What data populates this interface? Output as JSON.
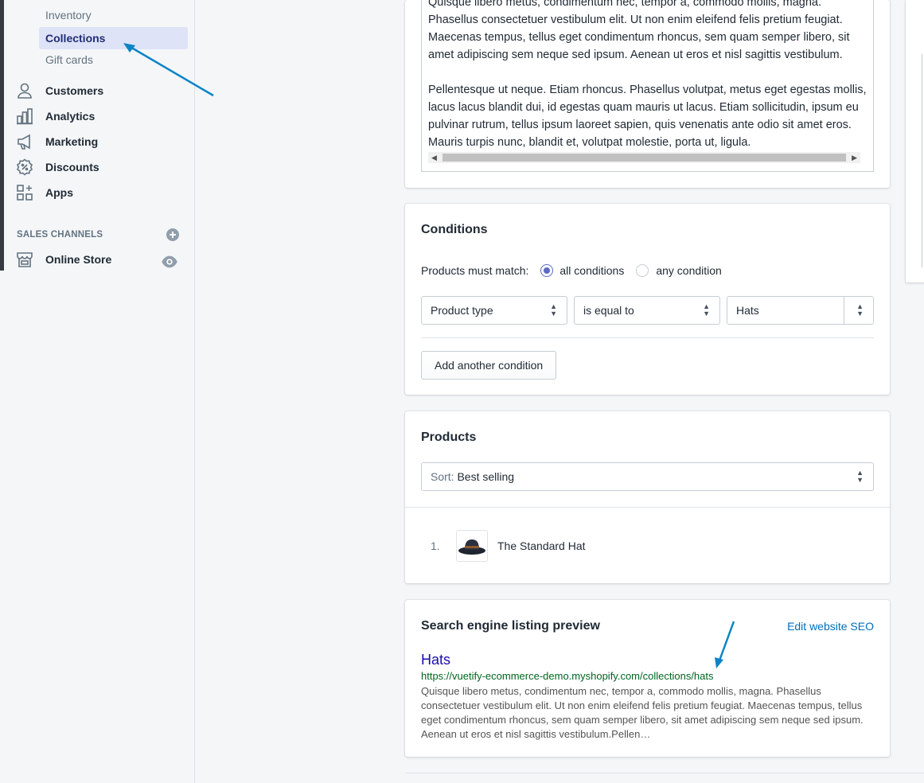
{
  "sidebar": {
    "sub_items": [
      {
        "label": "Inventory",
        "active": false
      },
      {
        "label": "Collections",
        "active": true
      },
      {
        "label": "Gift cards",
        "active": false
      }
    ],
    "nav_items": [
      {
        "label": "Customers",
        "icon": "customers-icon"
      },
      {
        "label": "Analytics",
        "icon": "analytics-icon"
      },
      {
        "label": "Marketing",
        "icon": "marketing-icon"
      },
      {
        "label": "Discounts",
        "icon": "discounts-icon"
      },
      {
        "label": "Apps",
        "icon": "apps-icon"
      }
    ],
    "sales_channels_heading": "SALES CHANNELS",
    "online_store": "Online Store"
  },
  "description": {
    "paragraphs": [
      "Quisque libero metus, condimentum nec, tempor a, commodo mollis, magna. Phasellus consectetuer vestibulum elit. Ut non enim eleifend felis pretium feugiat. Maecenas tempus, tellus eget condimentum rhoncus, sem quam semper libero, sit amet adipiscing sem neque sed ipsum. Aenean ut eros et nisl sagittis vestibulum.",
      "Pellentesque ut neque. Etiam rhoncus. Phasellus volutpat, metus eget egestas mollis, lacus lacus blandit dui, id egestas quam mauris ut lacus. Etiam sollicitudin, ipsum eu pulvinar rutrum, tellus ipsum laoreet sapien, quis venenatis ante odio sit amet eros. Mauris turpis nunc, blandit et, volutpat molestie, porta ut, ligula."
    ]
  },
  "conditions": {
    "title": "Conditions",
    "match_label": "Products must match:",
    "all_label": "all conditions",
    "any_label": "any condition",
    "field": "Product type",
    "operator": "is equal to",
    "value": "Hats",
    "add_button": "Add another condition"
  },
  "products": {
    "title": "Products",
    "sort_prefix": "Sort:",
    "sort_value": "Best selling",
    "items": [
      {
        "index": "1.",
        "name": "The Standard Hat",
        "thumbnail": "hat-image"
      }
    ]
  },
  "seo": {
    "title": "Search engine listing preview",
    "edit_link": "Edit website SEO",
    "page_title": "Hats",
    "url": "https://vuetify-ecommerce-demo.myshopify.com/collections/hats",
    "description": "Quisque libero metus, condimentum nec, tempor a, commodo mollis, magna. Phasellus consectetuer vestibulum elit. Ut non enim eleifend felis pretium feugiat. Maecenas tempus, tellus eget condimentum rhoncus, sem quam semper libero, sit amet adipiscing sem neque sed ipsum. Aenean ut eros et nisl sagittis vestibulum.Pellen…"
  },
  "colors": {
    "accent": "#5c6ac4",
    "annotation_arrow": "#0a84c6",
    "seo_title": "#1a0dab",
    "seo_url": "#006621"
  }
}
